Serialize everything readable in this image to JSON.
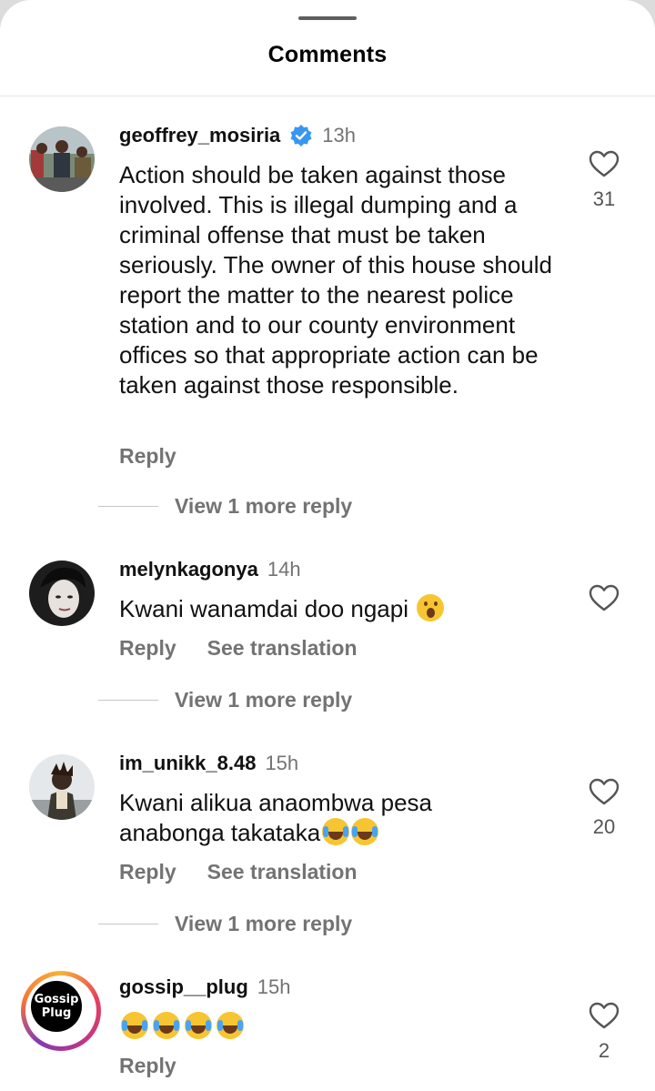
{
  "sheet": {
    "title": "Comments"
  },
  "comments": [
    {
      "username": "geoffrey_mosiria",
      "verified": true,
      "time": "13h",
      "text": "Action should be taken against those involved. This is illegal dumping and a criminal offense that must be taken seriously. The owner of this house should report the matter to the nearest police station and to our county environment offices so that appropriate action can be taken against those responsible.",
      "reply_label": "Reply",
      "like_count": "31",
      "view_replies": "View 1 more reply"
    },
    {
      "username": "melynkagonya",
      "time": "14h",
      "text": "Kwani wanamdai doo ngapi",
      "reply_label": "Reply",
      "translate_label": "See translation",
      "view_replies": "View 1 more reply"
    },
    {
      "username": "im_unikk_8.48",
      "time": "15h",
      "text_line1": "Kwani alikua anaombwa pesa",
      "text_line2": "anabonga takataka",
      "reply_label": "Reply",
      "translate_label": "See translation",
      "like_count": "20",
      "view_replies": "View 1 more reply"
    },
    {
      "username": "gossip__plug",
      "time": "15h",
      "avatar_text_line1": "Gossip",
      "avatar_text_line2": "Plug",
      "reply_label": "Reply",
      "like_count": "2"
    }
  ],
  "icons": {
    "like": "heart-outline-icon",
    "verified": "verified-badge-icon",
    "emoji_laugh": "face-with-tears-of-joy-icon",
    "emoji_wow": "face-with-open-mouth-icon"
  },
  "colors": {
    "verified_blue": "#3797f0",
    "secondary_text": "#737373",
    "background": "#ffffff"
  }
}
